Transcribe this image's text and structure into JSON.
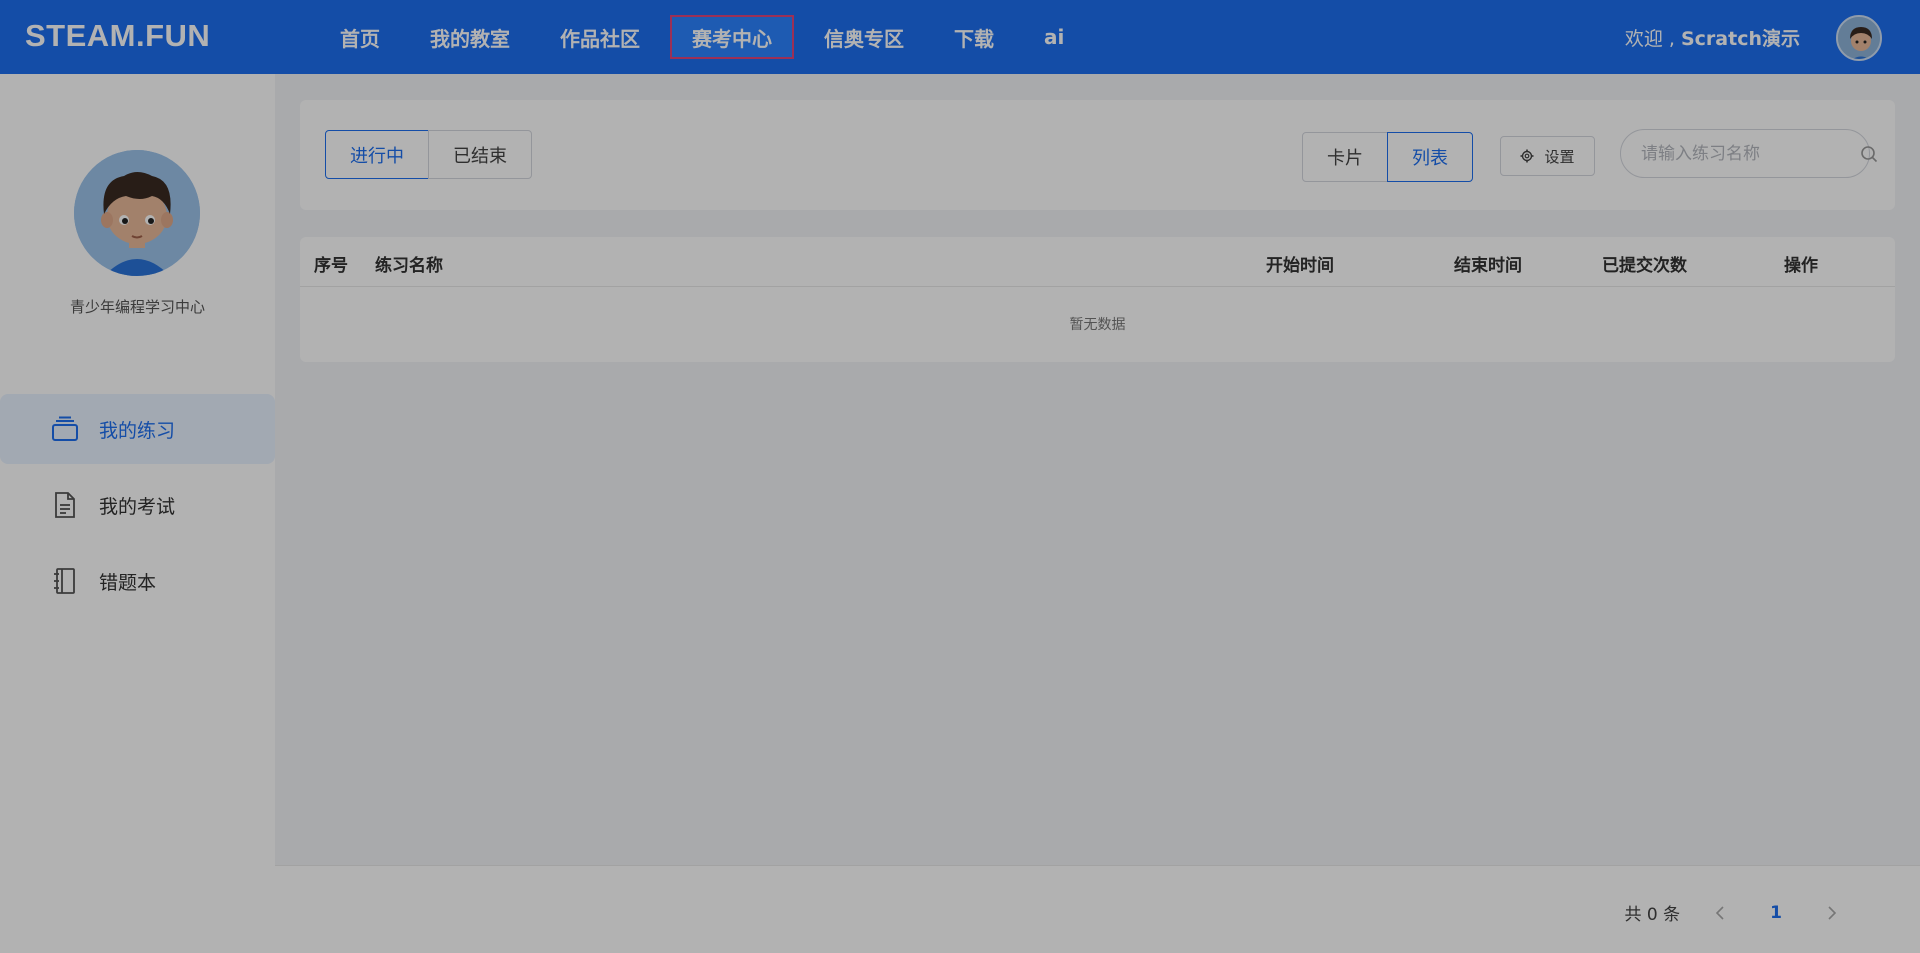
{
  "header": {
    "logo": "STEAM.FUN",
    "nav": [
      {
        "label": "首页",
        "active": false
      },
      {
        "label": "我的教室",
        "active": false
      },
      {
        "label": "作品社区",
        "active": false
      },
      {
        "label": "赛考中心",
        "active": true
      },
      {
        "label": "信奥专区",
        "active": false
      },
      {
        "label": "下载",
        "active": false
      },
      {
        "label": "ai",
        "active": false
      }
    ],
    "welcome_prefix": "欢迎 , ",
    "username": "Scratch演示"
  },
  "sidebar": {
    "subtitle": "青少年编程学习中心",
    "items": [
      {
        "label": "我的练习",
        "icon": "layers-icon",
        "active": true
      },
      {
        "label": "我的考试",
        "icon": "document-icon",
        "active": false
      },
      {
        "label": "错题本",
        "icon": "notebook-icon",
        "active": false
      }
    ]
  },
  "toolbar": {
    "status_tabs": [
      {
        "label": "进行中",
        "active": true
      },
      {
        "label": "已结束",
        "active": false
      }
    ],
    "view_tabs": [
      {
        "label": "卡片",
        "active": false
      },
      {
        "label": "列表",
        "active": true
      }
    ],
    "settings_label": "设置",
    "search_placeholder": "请输入练习名称"
  },
  "table": {
    "columns": [
      "序号",
      "练习名称",
      "开始时间",
      "结束时间",
      "已提交次数",
      "操作"
    ],
    "empty_text": "暂无数据"
  },
  "pagination": {
    "total_text": "共 0 条",
    "current_page": "1"
  },
  "colors": {
    "primary": "#1e6ff0",
    "nav_active_border": "#e0457b"
  }
}
